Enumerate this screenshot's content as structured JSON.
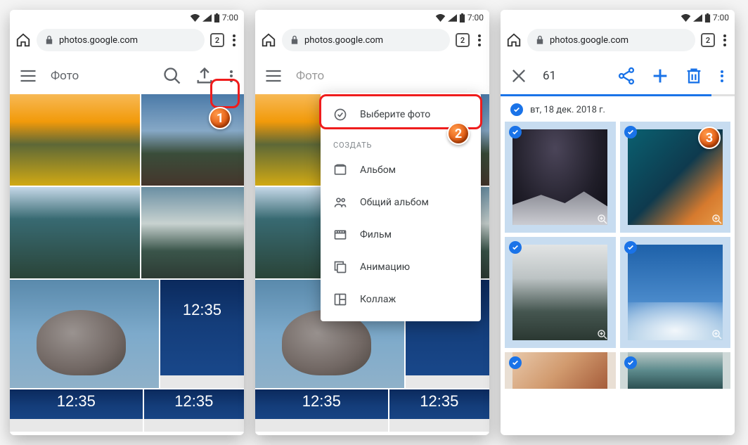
{
  "status": {
    "time": "7:00"
  },
  "browser": {
    "url": "photos.google.com",
    "tab_count": "2"
  },
  "screen1": {
    "title": "Фото"
  },
  "menu": {
    "select": "Выберите фото",
    "section": "Создать",
    "album": "Альбом",
    "shared_album": "Общий альбом",
    "movie": "Фильм",
    "animation": "Анимацию",
    "collage": "Коллаж"
  },
  "selection": {
    "count": "61",
    "date": "вт, 18 дек. 2018 г."
  },
  "markers": {
    "m1": "1",
    "m2": "2",
    "m3": "3"
  }
}
